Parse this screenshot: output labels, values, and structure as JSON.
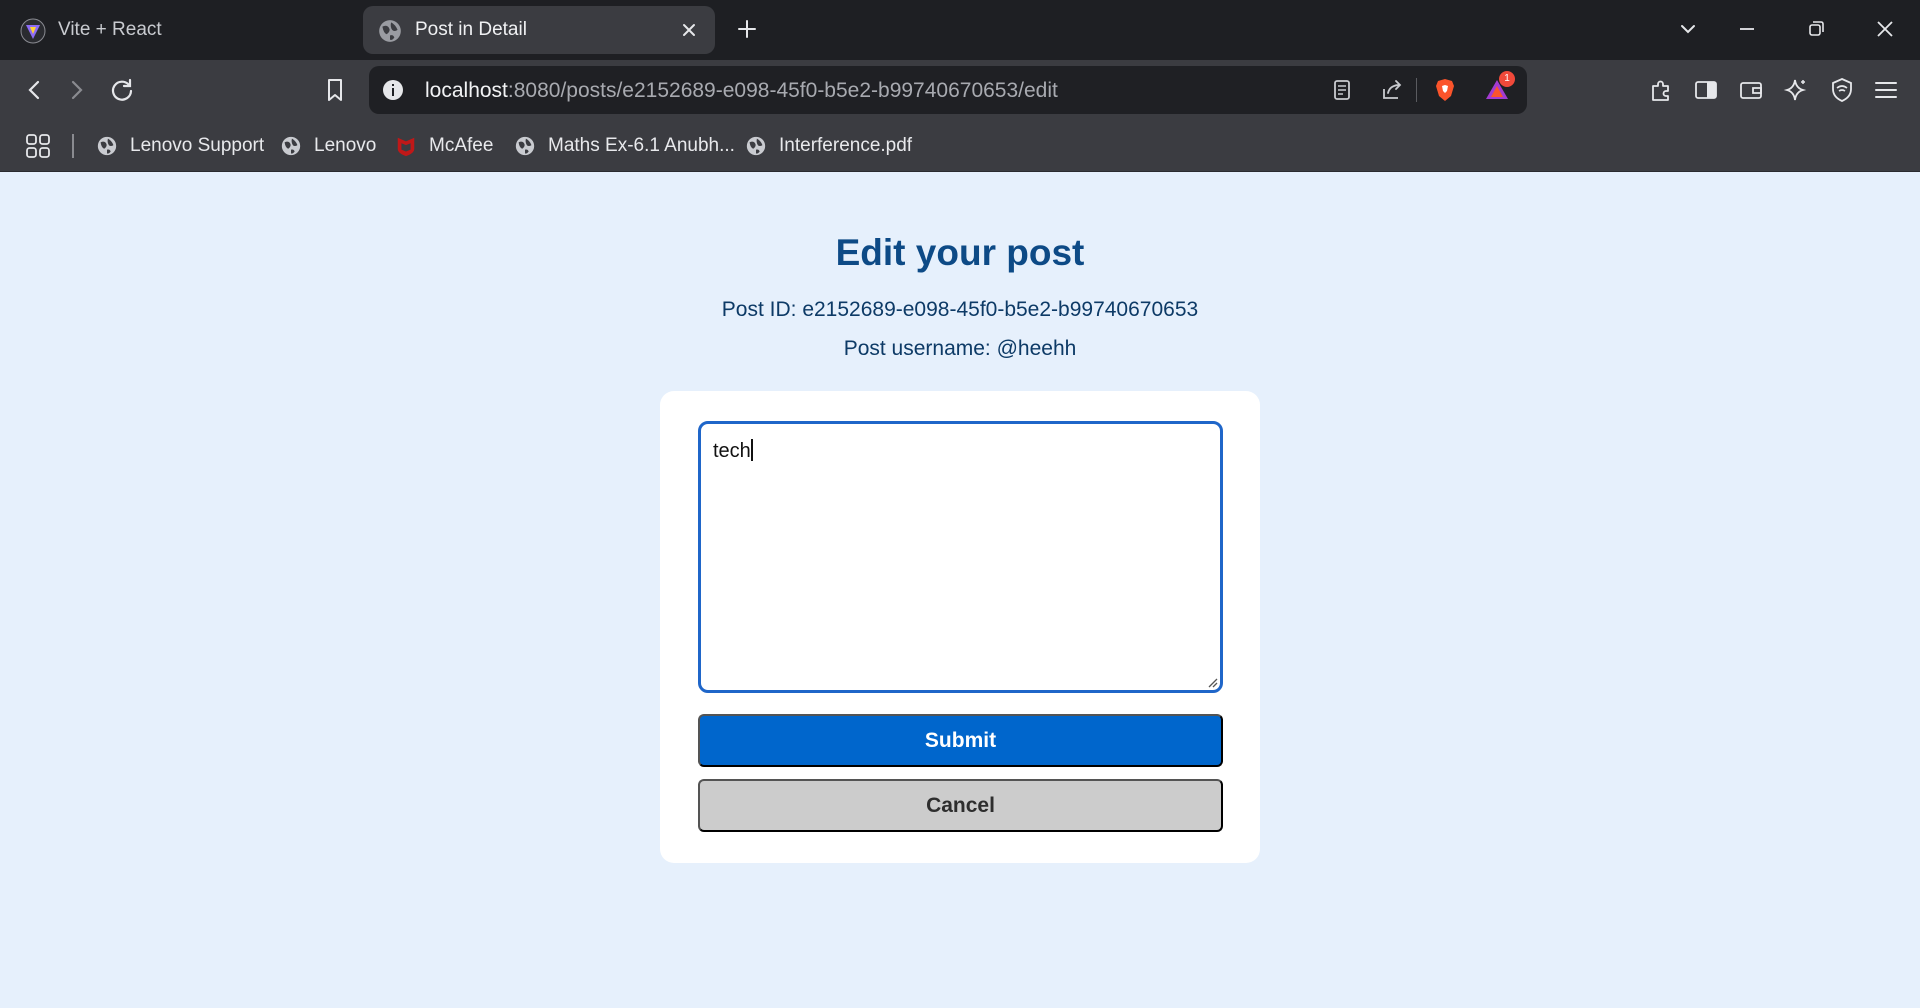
{
  "browser": {
    "tabs": [
      {
        "title": "Vite + React",
        "active": false,
        "icon": "vite-logo-icon"
      },
      {
        "title": "Post in Detail",
        "active": true,
        "icon": "globe-icon"
      }
    ],
    "url": {
      "host": "localhost",
      "rest": ":8080/posts/e2152689-e098-45f0-b5e2-b99740670653/edit"
    },
    "notification_count": "1",
    "bookmarks": [
      {
        "label": "Lenovo Support",
        "icon": "globe-icon"
      },
      {
        "label": "Lenovo",
        "icon": "globe-icon"
      },
      {
        "label": "McAfee",
        "icon": "mcafee-shield-icon"
      },
      {
        "label": "Maths Ex-6.1 Anubh...",
        "icon": "globe-icon"
      },
      {
        "label": "Interference.pdf",
        "icon": "globe-icon"
      }
    ],
    "colors": {
      "tabstrip": "#1e1f23",
      "toolbar": "#3b3c41",
      "brave_orange": "#fb542b"
    }
  },
  "page": {
    "heading": "Edit your post",
    "post_id_line": "Post ID: e2152689-e098-45f0-b5e2-b99740670653",
    "username_line": "Post username: @heehh",
    "editor_value": "tech",
    "submit_label": "Submit",
    "cancel_label": "Cancel",
    "colors": {
      "background": "#e6f0fc",
      "heading": "#0d4a86",
      "primary": "#0066cc",
      "secondary": "#cccccc"
    }
  }
}
